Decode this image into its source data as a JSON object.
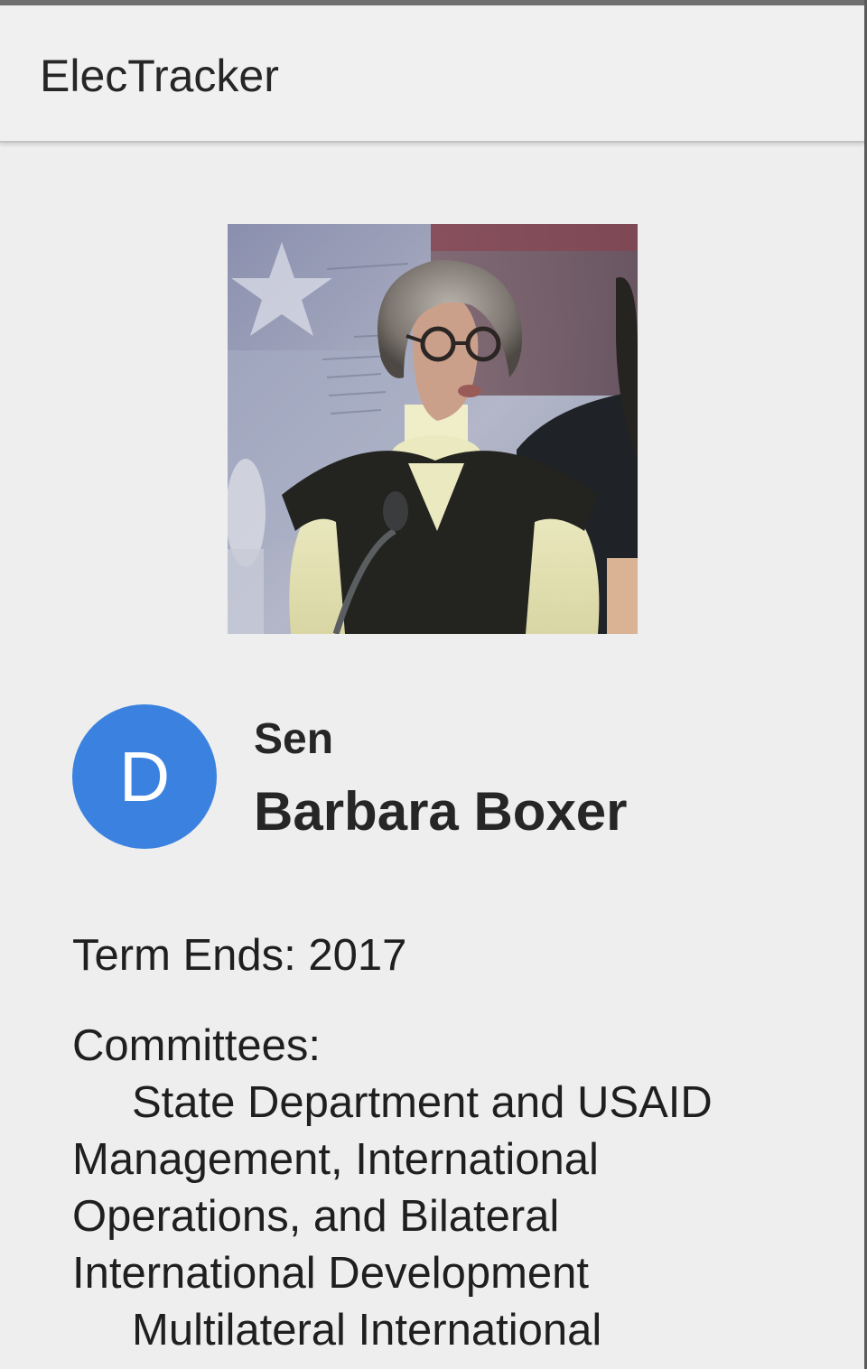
{
  "app": {
    "title": "ElecTracker"
  },
  "profile": {
    "photo_alt": "Barbara Boxer",
    "avatar_letter": "D",
    "title_prefix": "Sen",
    "name": "Barbara Boxer",
    "term_ends": "Term Ends: 2017",
    "committees_heading": "Committees:",
    "committees": [
      "State Department and USAID Management, International Operations, and Bilateral International Development",
      "Multilateral International"
    ]
  },
  "colors": {
    "avatar_bg": "#3b82e0",
    "page_bg": "#eeeeee",
    "appbar_bg": "#f0f0f0"
  }
}
